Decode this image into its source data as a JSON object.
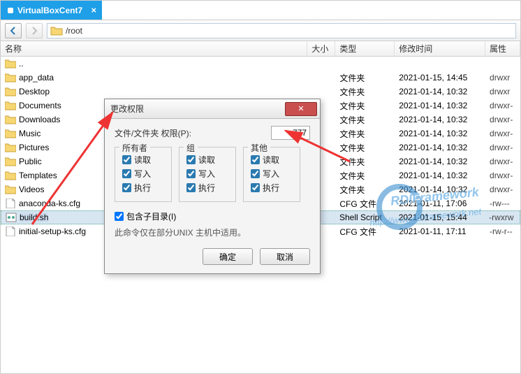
{
  "tab_title": "VirtualBoxCent7",
  "path": "/root",
  "columns": {
    "name": "名称",
    "size": "大小",
    "type": "类型",
    "mtime": "修改时间",
    "attr": "属性"
  },
  "rows": [
    {
      "icon": "folder",
      "name": "..",
      "type": "",
      "mtime": "",
      "attr": ""
    },
    {
      "icon": "folder",
      "name": "app_data",
      "type": "文件夹",
      "mtime": "2021-01-15, 14:45",
      "attr": "drwxr"
    },
    {
      "icon": "folder",
      "name": "Desktop",
      "type": "文件夹",
      "mtime": "2021-01-14, 10:32",
      "attr": "drwxr"
    },
    {
      "icon": "folder",
      "name": "Documents",
      "type": "文件夹",
      "mtime": "2021-01-14, 10:32",
      "attr": "drwxr-"
    },
    {
      "icon": "folder",
      "name": "Downloads",
      "type": "文件夹",
      "mtime": "2021-01-14, 10:32",
      "attr": "drwxr-"
    },
    {
      "icon": "folder",
      "name": "Music",
      "type": "文件夹",
      "mtime": "2021-01-14, 10:32",
      "attr": "drwxr-"
    },
    {
      "icon": "folder",
      "name": "Pictures",
      "type": "文件夹",
      "mtime": "2021-01-14, 10:32",
      "attr": "drwxr-"
    },
    {
      "icon": "folder",
      "name": "Public",
      "type": "文件夹",
      "mtime": "2021-01-14, 10:32",
      "attr": "drwxr-"
    },
    {
      "icon": "folder",
      "name": "Templates",
      "type": "文件夹",
      "mtime": "2021-01-14, 10:32",
      "attr": "drwxr-"
    },
    {
      "icon": "folder",
      "name": "Videos",
      "type": "文件夹",
      "mtime": "2021-01-14, 10:32",
      "attr": "drwxr-"
    },
    {
      "icon": "file",
      "name": "anaconda-ks.cfg",
      "type": "CFG 文件",
      "mtime": "2021-01-11, 17:06",
      "attr": "-rw---"
    },
    {
      "icon": "sh",
      "name": "build.sh",
      "type": "Shell Script",
      "mtime": "2021-01-15, 15:44",
      "attr": "-rwxrw",
      "selected": true
    },
    {
      "icon": "file",
      "name": "initial-setup-ks.cfg",
      "type": "CFG 文件",
      "mtime": "2021-01-11, 17:11",
      "attr": "-rw-r--"
    }
  ],
  "dialog": {
    "title": "更改权限",
    "perm_label": "文件/文件夹 权限(P):",
    "perm_value": "777",
    "groups": {
      "owner": "所有者",
      "group": "组",
      "other": "其他",
      "read": "读取",
      "write": "写入",
      "exec": "执行"
    },
    "subdir_label": "包含子目录(I)",
    "note": "此命令仅在部分UNIX 主机中适用。",
    "ok": "确定",
    "cancel": "取消"
  },
  "watermark": {
    "line1": "RDIFramework",
    "line2": "http://www.rdiframework.net"
  }
}
